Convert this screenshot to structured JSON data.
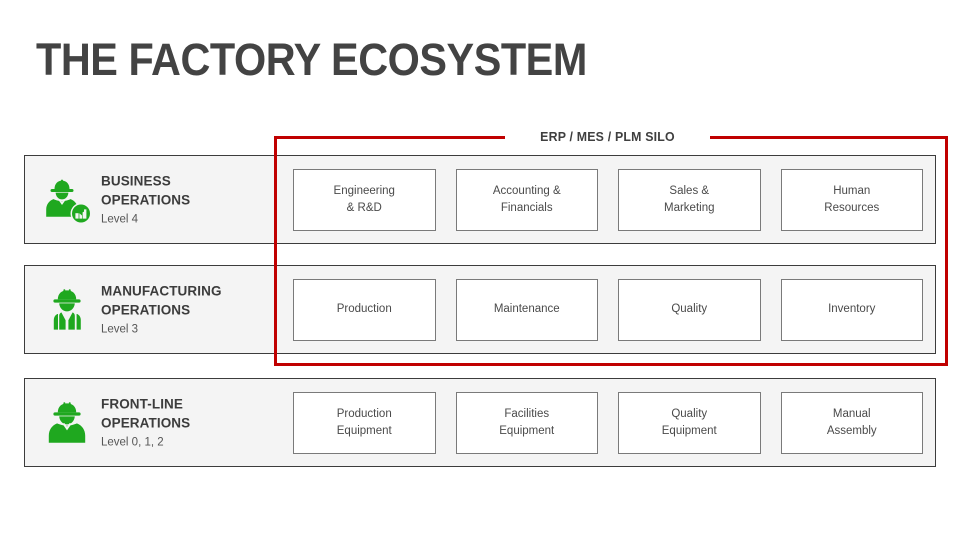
{
  "page_title": "THE FACTORY ECOSYSTEM",
  "silo": {
    "label": "ERP / MES / PLM SILO",
    "border_color": "#C00000"
  },
  "colors": {
    "accent_green": "#1FA81F",
    "silo_red": "#C00000",
    "band_background": "#F4F4F4",
    "band_border": "#3C3C3C",
    "title_text": "#434343",
    "box_text": "#4A4A4A"
  },
  "rows": [
    {
      "id": "business-operations",
      "icon": "worker-business-icon",
      "title": "BUSINESS\nOPERATIONS",
      "title_line1": "BUSINESS",
      "title_line2": "OPERATIONS",
      "level": "Level 4",
      "boxes": [
        "Engineering\n& R&D",
        "Accounting &\nFinancials",
        "Sales &\nMarketing",
        "Human\nResources"
      ]
    },
    {
      "id": "manufacturing-operations",
      "icon": "worker-vest-icon",
      "title": "MANUFACTURING\nOPERATIONS",
      "title_line1": "MANUFACTURING",
      "title_line2": "OPERATIONS",
      "level": "Level 3",
      "boxes": [
        "Production",
        "Maintenance",
        "Quality",
        "Inventory"
      ]
    },
    {
      "id": "front-line-operations",
      "icon": "worker-plain-icon",
      "title": "FRONT-LINE\nOPERATIONS",
      "title_line1": "FRONT-LINE",
      "title_line2": "OPERATIONS",
      "level": "Level 0, 1, 2",
      "boxes": [
        "Production\nEquipment",
        "Facilities\nEquipment",
        "Quality\nEquipment",
        "Manual\nAssembly"
      ]
    }
  ]
}
